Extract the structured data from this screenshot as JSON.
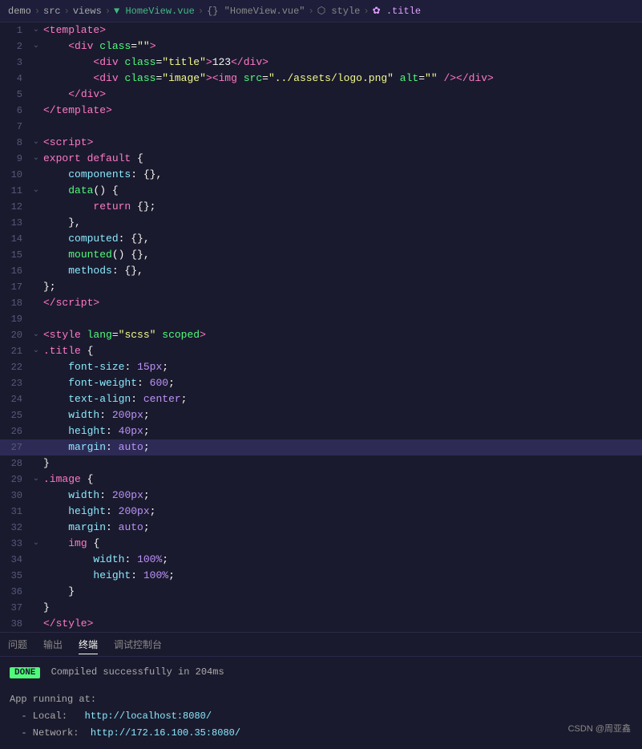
{
  "breadcrumb": {
    "items": [
      {
        "label": "demo",
        "type": "normal"
      },
      {
        "label": ">",
        "type": "sep"
      },
      {
        "label": "src",
        "type": "normal"
      },
      {
        "label": ">",
        "type": "sep"
      },
      {
        "label": "views",
        "type": "normal"
      },
      {
        "label": ">",
        "type": "sep"
      },
      {
        "label": "▼ HomeView.vue",
        "type": "vue"
      },
      {
        "label": ">",
        "type": "sep"
      },
      {
        "label": "{} \"HomeView.vue\"",
        "type": "obj"
      },
      {
        "label": ">",
        "type": "sep"
      },
      {
        "label": "⬡ style",
        "type": "style"
      },
      {
        "label": ">",
        "type": "sep"
      },
      {
        "label": "✿ .title",
        "type": "title"
      }
    ]
  },
  "panel": {
    "tabs": [
      "问题",
      "输出",
      "终端",
      "调试控制台"
    ],
    "active_tab": "终端"
  },
  "terminal": {
    "done_label": "DONE",
    "compiled_msg": "Compiled successfully in 204ms",
    "app_running": "App running at:",
    "local_label": "- Local:",
    "local_url": "http://localhost:8080/",
    "network_label": "- Network:",
    "network_url": "http://172.16.100.35:8080/"
  },
  "watermark": "CSDN @周亚鑫"
}
